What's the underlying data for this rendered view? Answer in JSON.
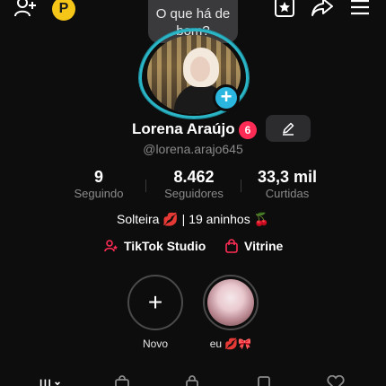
{
  "tooltip": {
    "text_line1": "O que há de",
    "text_line2": "bom?"
  },
  "top_bar": {
    "icons": [
      "add-friend-icon",
      "points-coin-icon",
      "favorites-star-icon",
      "share-icon",
      "menu-icon"
    ],
    "coin_label": "P"
  },
  "profile": {
    "name": "Lorena Araújo",
    "notification_count": "6",
    "username": "@lorena.arajo645",
    "bio": "Solteira 💋 | 19 aninhos 🍒"
  },
  "stats": [
    {
      "value": "9",
      "label": "Seguindo"
    },
    {
      "value": "8.462",
      "label": "Seguidores"
    },
    {
      "value": "33,3 mil",
      "label": "Curtidas"
    }
  ],
  "links": [
    {
      "label": "TikTok Studio",
      "icon": "studio-person-icon"
    },
    {
      "label": "Vitrine",
      "icon": "shopping-bag-icon"
    }
  ],
  "stories": [
    {
      "label": "Novo",
      "icon": "plus-icon"
    },
    {
      "label": "eu 💋🎀"
    }
  ],
  "colors": {
    "accent_red": "#fe2c55",
    "ring_teal": "#2bb6c7",
    "badge_blue": "#2bb6e0",
    "coin_yellow": "#f5c518"
  }
}
